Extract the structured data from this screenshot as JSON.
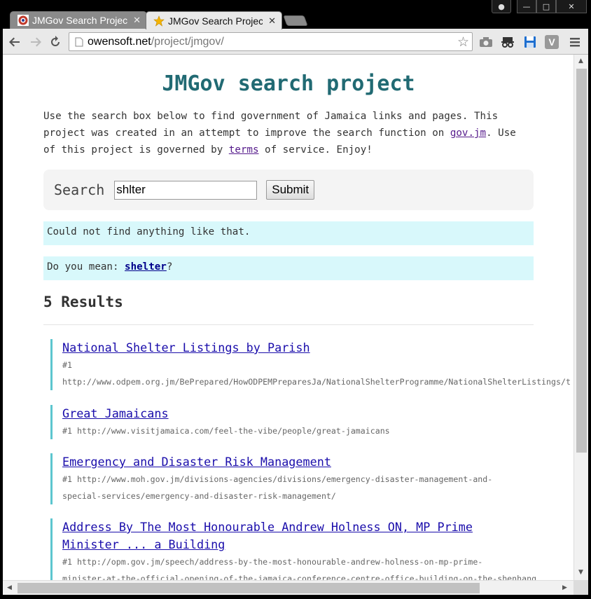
{
  "tabs": [
    {
      "title": "JMGov Search Project",
      "active": false
    },
    {
      "title": "JMGov Search Project",
      "active": true
    }
  ],
  "address": {
    "host": "owensoft.net",
    "path": "/project/jmgov/"
  },
  "page": {
    "title": "JMGov search project",
    "intro_1": "Use the search box below to find government of Jamaica links and pages. This project was created in an attempt to improve the search function on ",
    "intro_link": "gov.jm",
    "intro_2": ". Use of this project is governed by ",
    "terms_link": "terms",
    "intro_3": " of service. Enjoy!",
    "search_label": "Search",
    "search_value": "shlter",
    "submit_label": "Submit",
    "not_found": "Could not find anything like that.",
    "suggest_prefix": "Do you mean: ",
    "suggest_word": "shelter",
    "suggest_suffix": "?",
    "results_count": "5 Results"
  },
  "results": [
    {
      "title": "National Shelter Listings by Parish",
      "line1": "#1",
      "line2": "http://www.odpem.org.jm/BePrepared/HowODPEMPreparesJa/NationalShelterProgramme/NationalShelterListings/t"
    },
    {
      "title": "Great Jamaicans",
      "line1": "#1 http://www.visitjamaica.com/feel-the-vibe/people/great-jamaicans"
    },
    {
      "title": "Emergency and Disaster Risk Management",
      "line1": "#1 http://www.moh.gov.jm/divisions-agencies/divisions/emergency-disaster-management-and-",
      "line2": "special-services/emergency-and-disaster-risk-management/"
    },
    {
      "title": "Address By The Most Honourable Andrew Holness ON, MP Prime",
      "title2": "Minister ... a Building",
      "line1": "#1 http://opm.gov.jm/speech/address-by-the-most-honourable-andrew-holness-on-mp-prime-",
      "line2": "minister-at-the-official-opening-of-the-jamaica-conference-centre-office-building-on-the-shenhang"
    }
  ]
}
